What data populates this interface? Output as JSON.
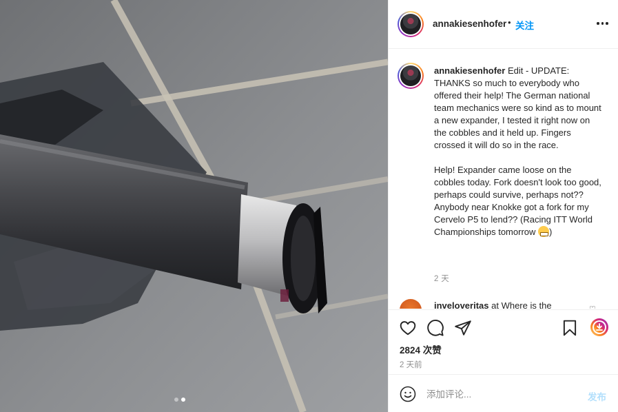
{
  "post": {
    "image_description": "carbon fork steerer tube with headset expander",
    "carousel": {
      "count": 2,
      "active_index": 1
    }
  },
  "header": {
    "username": "annakiesenhofer",
    "separator": "•",
    "follow_label": "关注"
  },
  "caption": {
    "username": "annakiesenhofer",
    "paragraph1": "Edit - UPDATE: THANKS so much to everybody who offered their help! The German national team mechanics were so kind as to mount a new expander, I tested it right now on the cobbles and it held up. Fingers crossed it will do so in the race.",
    "paragraph2": "Help! Expander came loose on the cobbles today. Fork doesn't look too good, perhaps could survive, perhaps not?? Anybody near Knokke got a fork for my Cervelo P5 to lend?? (Racing ITT World Championships tomorrow",
    "paragraph2_end": ")",
    "emoji": "grimacing-face",
    "time": "2 天"
  },
  "comments": [
    {
      "username": "inveloveritas",
      "text": "at Where is the"
    }
  ],
  "actions": {
    "likes": "2824 次赞",
    "date": "2 天前"
  },
  "comment_box": {
    "placeholder": "添加评论...",
    "post_label": "发布"
  },
  "colors": {
    "accent": "#0095f6",
    "post_disabled": "#b2dffc",
    "muted": "#8e8e8e",
    "text": "#262626"
  }
}
